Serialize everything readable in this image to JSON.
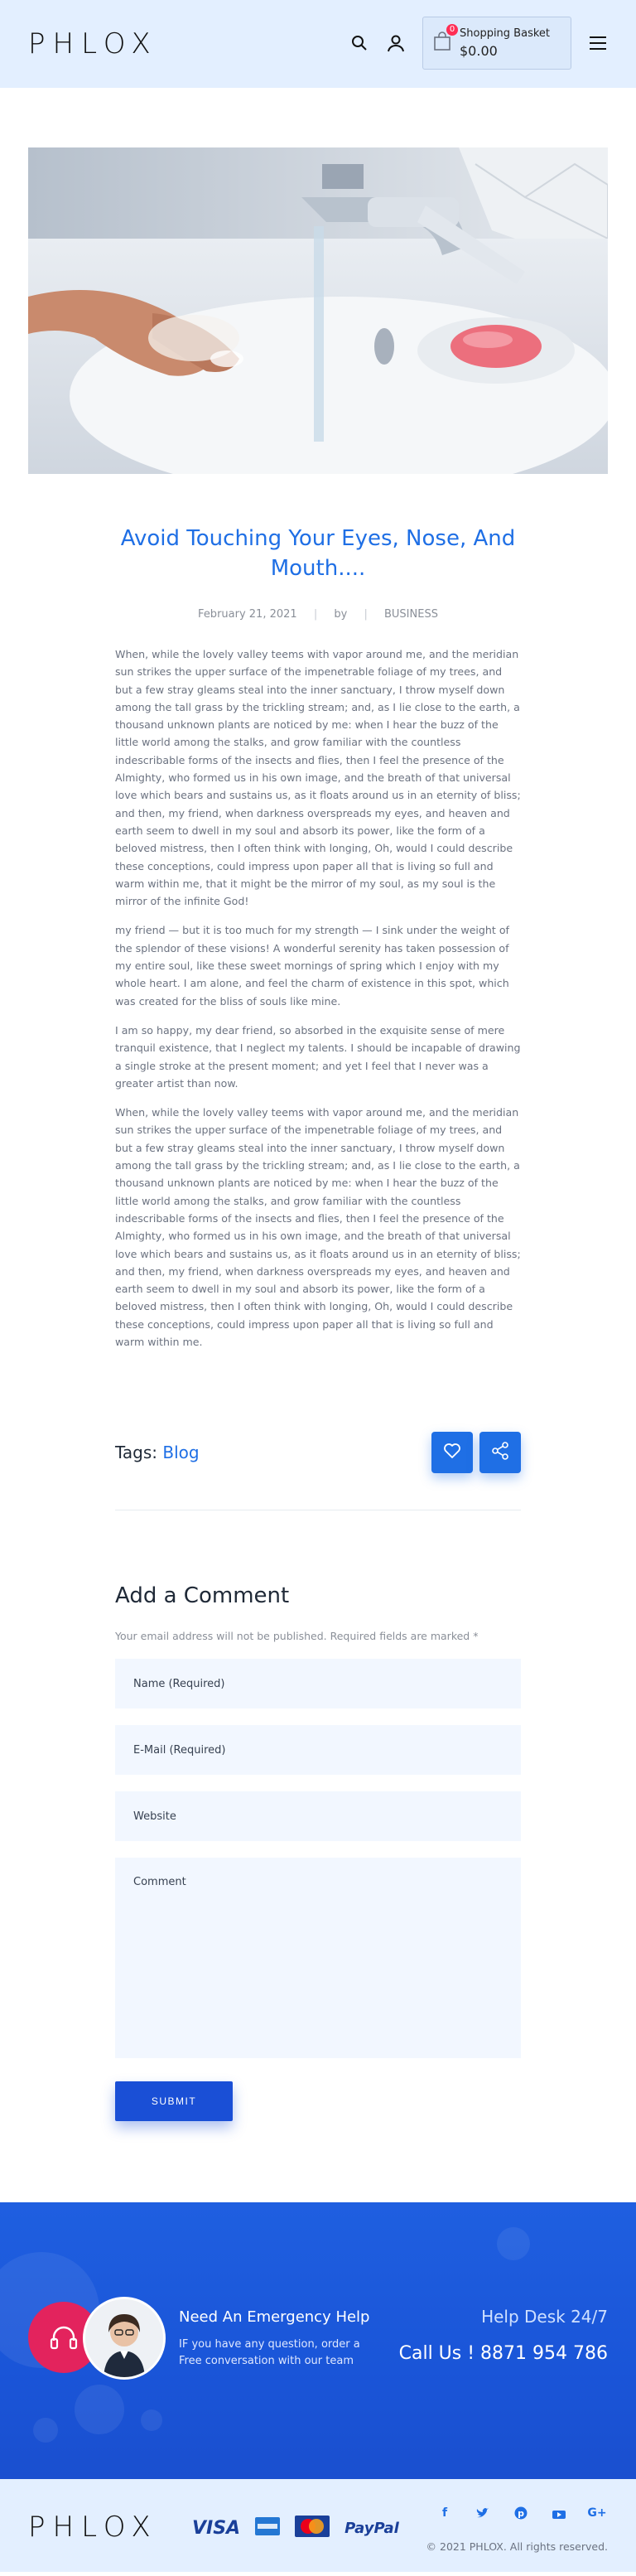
{
  "header": {
    "logo": "PHLOX",
    "basket_label": "Shopping Basket",
    "basket_amount": "$0.00",
    "basket_count": "0"
  },
  "post": {
    "title": "Avoid Touching Your Eyes, Nose, And Mouth....",
    "date": "February 21, 2021",
    "by": "by",
    "category": "BUSINESS",
    "paragraphs": [
      "When, while the lovely valley teems with vapor around me, and the meridian sun strikes the upper surface of the impenetrable foliage of my trees, and but a few stray gleams steal into the inner sanctuary, I throw myself down among the tall grass by the trickling stream; and, as I lie close to the earth, a thousand unknown plants are noticed by me: when I hear the buzz of the little world among the stalks, and grow familiar with the countless indescribable forms of the insects and flies, then I feel the presence of the Almighty, who formed us in his own image, and the breath of that universal love which bears and sustains us, as it floats around us in an eternity of bliss; and then, my friend, when darkness overspreads my eyes, and heaven and earth seem to dwell in my soul and absorb its power, like the form of a beloved mistress, then I often think with longing, Oh, would I could describe these conceptions, could impress upon paper all that is living so full and warm within me, that it might be the mirror of my soul, as my soul is the mirror of the infinite God!",
      "my friend — but it is too much for my strength — I sink under the weight of the splendor of these visions! A wonderful serenity has taken possession of my entire soul, like these sweet mornings of spring which I enjoy with my whole heart. I am alone, and feel the charm of existence in this spot, which was created for the bliss of souls like mine.",
      "I am so happy, my dear friend, so absorbed in the exquisite sense of mere tranquil existence, that I neglect my talents. I should be incapable of drawing a single stroke at the present moment; and yet I feel that I never was a greater artist than now.",
      "When, while the lovely valley teems with vapor around me, and the meridian sun strikes the upper surface of the impenetrable foliage of my trees, and but a few stray gleams steal into the inner sanctuary, I throw myself down among the tall grass by the trickling stream; and, as I lie close to the earth, a thousand unknown plants are noticed by me: when I hear the buzz of the little world among the stalks, and grow familiar with the countless indescribable forms of the insects and flies, then I feel the presence of the Almighty, who formed us in his own image, and the breath of that universal love which bears and sustains us, as it floats around us in an eternity of bliss; and then, my friend, when darkness overspreads my eyes, and heaven and earth seem to dwell in my soul and absorb its power, like the form of a beloved mistress, then I often think with longing, Oh, would I could describe these conceptions, could impress upon paper all that is living so full and warm within me."
    ],
    "tags_label": "Tags:",
    "tag": "Blog"
  },
  "comment": {
    "title": "Add a Comment",
    "note": "Your email address will not be published. Required fields are marked *",
    "name_placeholder": "Name (Required)",
    "email_placeholder": "E-Mail (Required)",
    "website_placeholder": "Website",
    "comment_placeholder": "Comment",
    "submit_label": "SUBMIT"
  },
  "help": {
    "title": "Need An Emergency Help",
    "subtitle": "IF you have any question, order a Free conversation with our team",
    "desk": "Help Desk 24/7",
    "call": "Call Us ! 8871 954 786"
  },
  "footer": {
    "logo": "PHLOX",
    "card_visa": "VISA",
    "card_paypal": "PayPal",
    "copyright": "© 2021 PHLOX. All rights reserved."
  },
  "colors": {
    "accent": "#1f6fe5",
    "header_bg": "#e3efff",
    "help_bg": "#1f5fe0",
    "badge": "#ff2e55"
  },
  "icons": [
    "search-icon",
    "user-icon",
    "basket-icon",
    "menu-icon",
    "heart-icon",
    "share-icon",
    "headset-icon",
    "facebook-icon",
    "twitter-icon",
    "pinterest-icon",
    "youtube-icon",
    "google-plus-icon"
  ]
}
